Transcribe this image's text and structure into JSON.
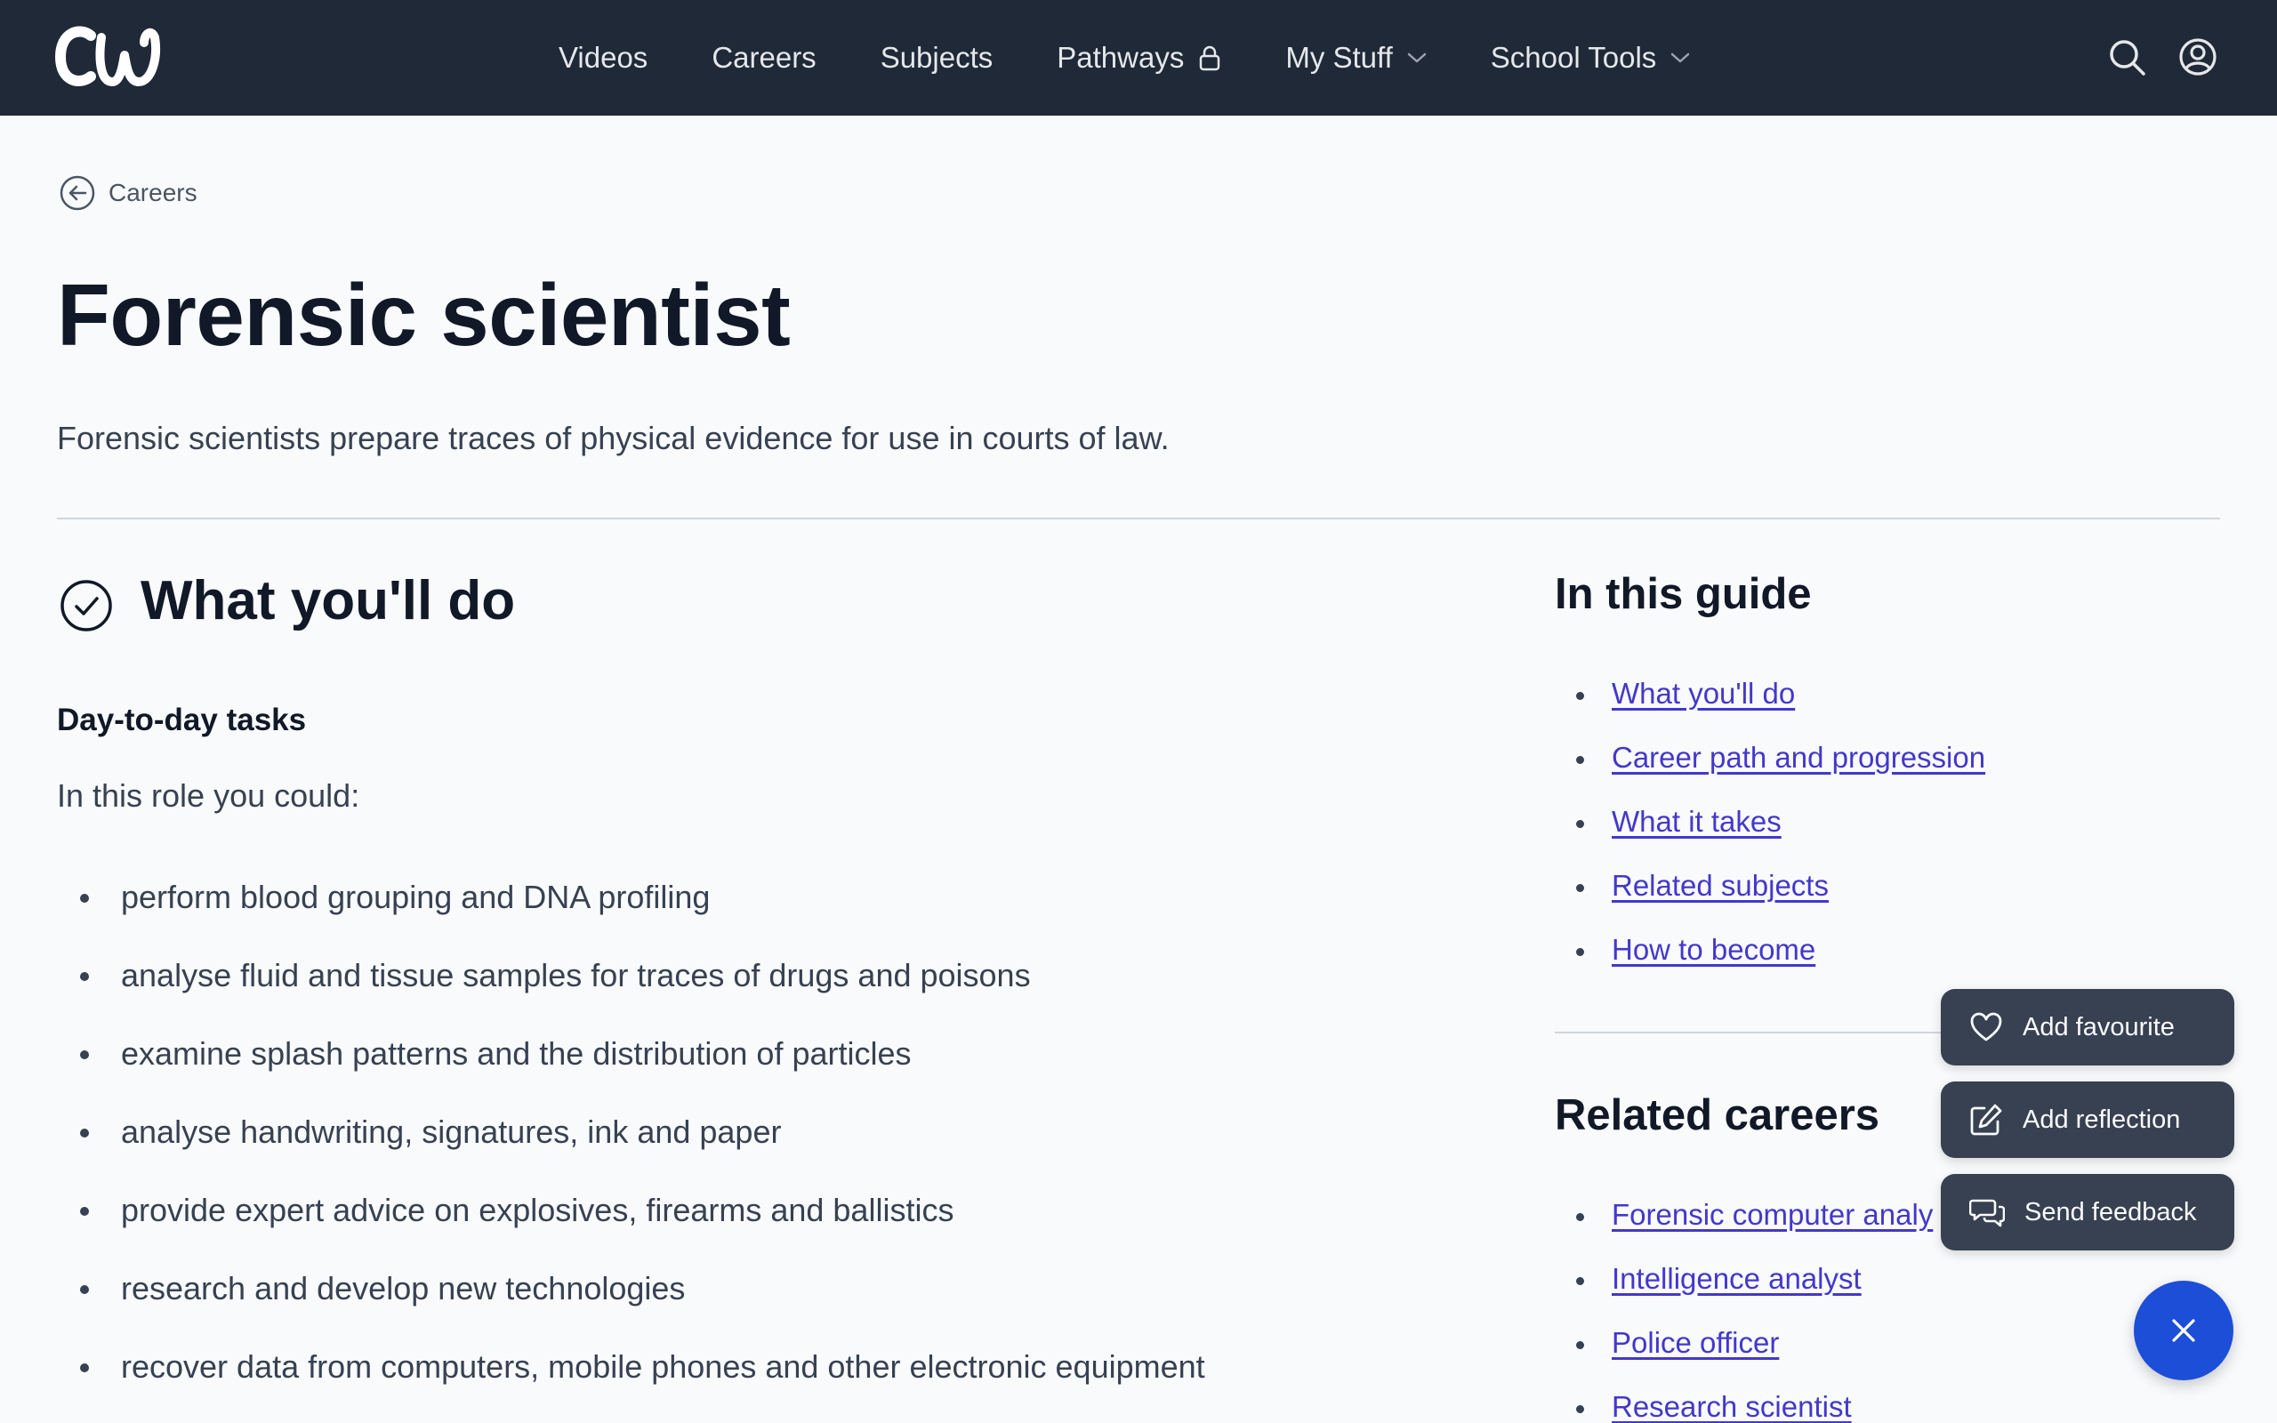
{
  "header": {
    "logo_text": "CW",
    "nav": [
      {
        "label": "Videos"
      },
      {
        "label": "Careers"
      },
      {
        "label": "Subjects"
      },
      {
        "label": "Pathways",
        "icon": "lock-icon"
      },
      {
        "label": "My Stuff",
        "icon": "chevron-down-icon"
      },
      {
        "label": "School Tools",
        "icon": "chevron-down-icon"
      }
    ],
    "icons": [
      "search-icon",
      "user-account-icon"
    ]
  },
  "breadcrumb": {
    "label": "Careers",
    "icon": "back-arrow-icon"
  },
  "page": {
    "title": "Forensic scientist",
    "description": "Forensic scientists prepare traces of physical evidence for use in courts of law."
  },
  "what_youll_do": {
    "title": "What you'll do",
    "icon": "check-circle-icon",
    "subheading": "Day-to-day tasks",
    "intro": "In this role you could:",
    "tasks": [
      "perform blood grouping and DNA profiling",
      "analyse fluid and tissue samples for traces of drugs and poisons",
      "examine splash patterns and the distribution of particles",
      "analyse handwriting, signatures, ink and paper",
      "provide expert advice on explosives, firearms and ballistics",
      "research and develop new technologies",
      "recover data from computers, mobile phones and other electronic equipment"
    ]
  },
  "guide": {
    "title": "In this guide",
    "links": [
      "What you'll do",
      "Career path and progression",
      "What it takes",
      "Related subjects",
      "How to become"
    ]
  },
  "related": {
    "title": "Related careers",
    "links": [
      "Forensic computer analy",
      "Intelligence analyst",
      "Police officer",
      "Research scientist"
    ]
  },
  "fab": {
    "actions": [
      {
        "label": "Add favourite",
        "icon": "heart-icon"
      },
      {
        "label": "Add reflection",
        "icon": "edit-icon"
      },
      {
        "label": "Send feedback",
        "icon": "feedback-icon"
      }
    ],
    "close_icon": "close-icon"
  },
  "colors": {
    "header_bg": "#1f2937",
    "link": "#4338ca",
    "fab_bg": "#374151",
    "fab_close_bg": "#1d4ed8",
    "page_bg": "#f8fafc"
  }
}
